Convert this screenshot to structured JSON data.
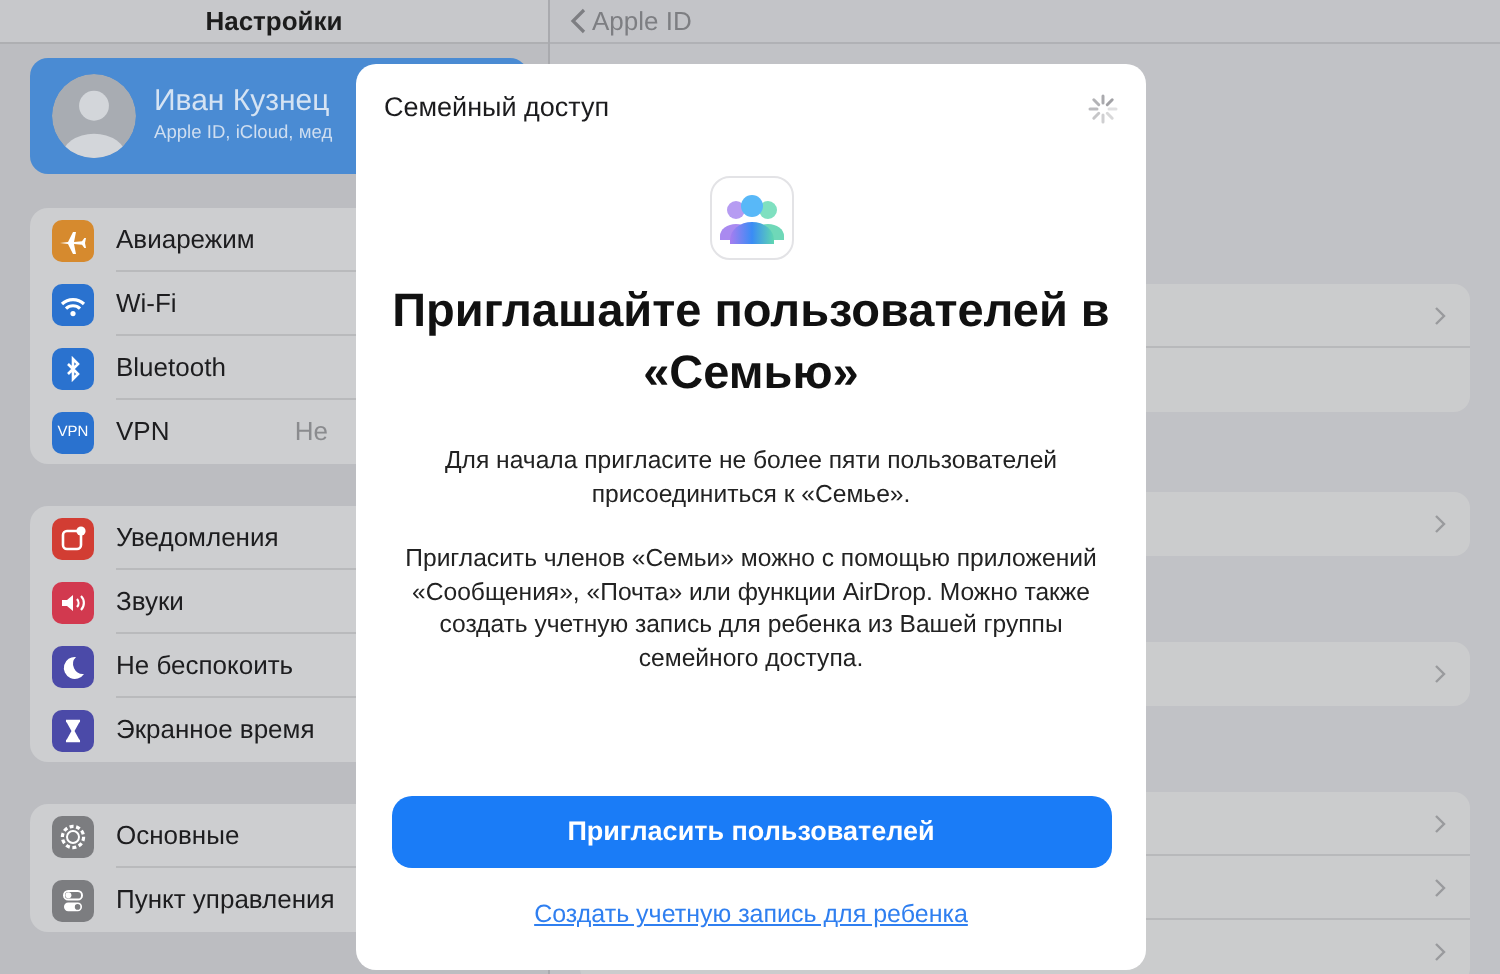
{
  "sidebar": {
    "title": "Настройки",
    "profile": {
      "name": "Иван Кузнец",
      "subtitle": "Apple ID, iCloud, мед"
    },
    "groups": [
      [
        {
          "kind": "airplane",
          "label": "Авиарежим",
          "color": "#d68a2e"
        },
        {
          "kind": "wifi",
          "label": "Wi-Fi",
          "color": "#2a72cf"
        },
        {
          "kind": "bluetooth",
          "label": "Bluetooth",
          "color": "#2a72cf"
        },
        {
          "kind": "vpn",
          "icon_text": "VPN",
          "label": "VPN",
          "value": "Не",
          "color": "#2a72cf"
        }
      ],
      [
        {
          "kind": "notifications",
          "label": "Уведомления",
          "color": "#d23d33"
        },
        {
          "kind": "sounds",
          "label": "Звуки",
          "color": "#d2394f"
        },
        {
          "kind": "moon",
          "label": "Не беспокоить",
          "color": "#4b4aa8"
        },
        {
          "kind": "hourglass",
          "label": "Экранное время",
          "color": "#4b4aa8"
        }
      ],
      [
        {
          "kind": "gear",
          "label": "Основные",
          "color": "#7c7d80"
        },
        {
          "kind": "toggles",
          "label": "Пункт управления",
          "color": "#7c7d80"
        }
      ]
    ]
  },
  "detail": {
    "back_label": "Apple ID",
    "groups": [
      {
        "rows": [
          {
            "chevron": true
          },
          {
            "chevron": false
          }
        ]
      },
      {
        "rows": [
          {
            "chevron": true
          }
        ]
      },
      {
        "rows": [
          {
            "chevron": true
          }
        ]
      },
      {
        "rows": [
          {
            "chevron": true
          },
          {
            "chevron": true
          },
          {
            "chevron": true
          }
        ]
      }
    ]
  },
  "modal": {
    "title": "Семейный доступ",
    "loading": true,
    "heading": "Приглашайте пользователей в «Семью»",
    "paragraphs": [
      "Для начала пригласите не более пяти пользователей присоединиться к «Семье».",
      "Пригласить членов «Семьи» можно с помощью приложений «Сообщения», «Почта» или функции AirDrop. Можно также создать учетную запись для ребенка из Вашей группы семейного доступа."
    ],
    "primary_button": "Пригласить пользователей",
    "link": "Создать учетную запись для ребенка"
  }
}
